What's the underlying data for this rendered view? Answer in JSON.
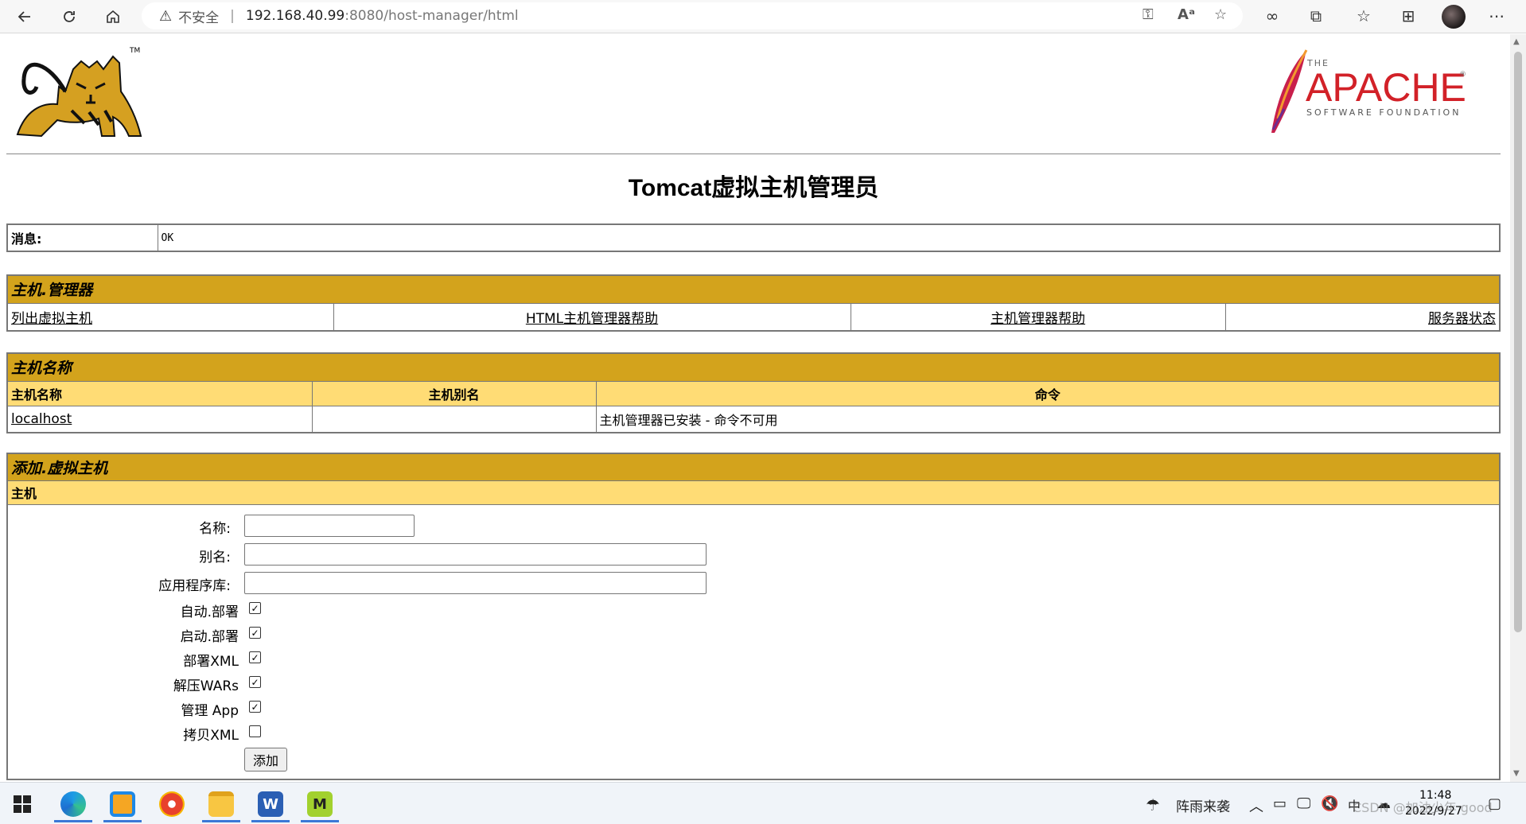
{
  "browser": {
    "security_label": "不安全",
    "url_host": "192.168.40.99",
    "url_path": ":8080/host-manager/html"
  },
  "page": {
    "title": "Tomcat虚拟主机管理员",
    "apache_the": "THE",
    "apache_name": "APACHE",
    "apache_sub": "SOFTWARE FOUNDATION",
    "tm": "TM"
  },
  "message": {
    "label": "消息:",
    "value": "OK"
  },
  "manager": {
    "header": "主机.管理器",
    "links": [
      "列出虚拟主机",
      "HTML主机管理器帮助",
      "主机管理器帮助",
      "服务器状态"
    ]
  },
  "hosts": {
    "header": "主机名称",
    "columns": [
      "主机名称",
      "主机别名",
      "命令"
    ],
    "rows": [
      {
        "name": "localhost",
        "alias": "",
        "command": "主机管理器已安装 - 命令不可用"
      }
    ]
  },
  "add_host": {
    "header": "添加.虚拟主机",
    "subheader": "主机",
    "name_label": "名称:",
    "aliases_label": "别名:",
    "appbase_label": "应用程序库:",
    "checkboxes": [
      {
        "label": "自动.部署",
        "checked": true
      },
      {
        "label": "启动.部署",
        "checked": true
      },
      {
        "label": "部署XML",
        "checked": true
      },
      {
        "label": "解压WARs",
        "checked": true
      },
      {
        "label": "管理 App",
        "checked": true
      },
      {
        "label": "拷贝XML",
        "checked": false
      }
    ],
    "submit_label": "添加"
  },
  "taskbar": {
    "weather": "阵雨来袭",
    "time": "11:48",
    "date": "2022/9/27",
    "watermark": "CSDN @加油少年 good"
  }
}
